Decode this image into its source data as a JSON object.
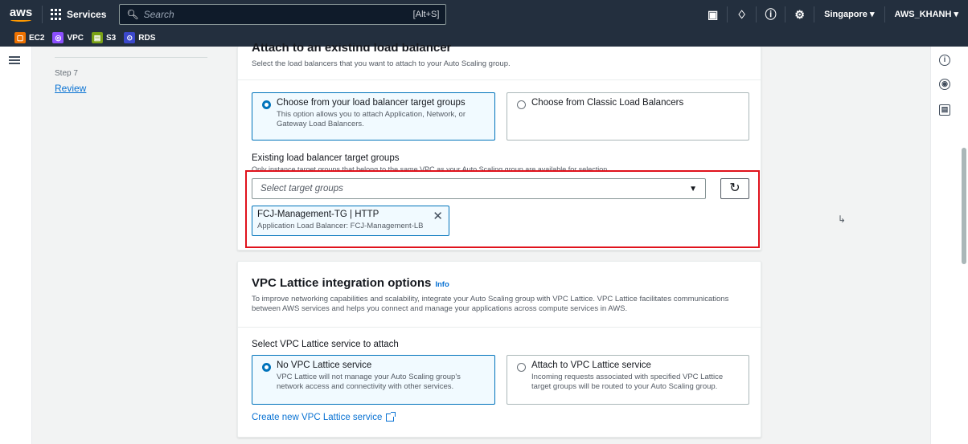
{
  "topbar": {
    "logo": "aws",
    "services_label": "Services",
    "search_placeholder": "Search",
    "search_shortcut": "[Alt+S]",
    "region": "Singapore ▾",
    "account": "AWS_KHANH ▾"
  },
  "favorites": [
    {
      "label": "EC2",
      "color": "#ed7100",
      "icon": "ec2-icon"
    },
    {
      "label": "VPC",
      "color": "#8c4fff",
      "icon": "vpc-icon"
    },
    {
      "label": "S3",
      "color": "#7aa116",
      "icon": "s3-icon"
    },
    {
      "label": "RDS",
      "color": "#3b48cc",
      "icon": "rds-icon"
    }
  ],
  "steps": {
    "step_label": "Step 7",
    "step_link": "Review"
  },
  "load_balancer": {
    "heading": "Attach to an existing load balancer",
    "subtitle": "Select the load balancers that you want to attach to your Auto Scaling group.",
    "option_target_groups": {
      "title": "Choose from your load balancer target groups",
      "desc": "This option allows you to attach Application, Network, or Gateway Load Balancers."
    },
    "option_classic": {
      "title": "Choose from Classic Load Balancers"
    },
    "existing_label": "Existing load balancer target groups",
    "existing_desc": "Only instance target groups that belong to the same VPC as your Auto Scaling group are available for selection.",
    "select_placeholder": "Select target groups",
    "selected_token": {
      "name": "FCJ-Management-TG | HTTP",
      "detail": "Application Load Balancer: FCJ-Management-LB"
    }
  },
  "lattice": {
    "heading": "VPC Lattice integration options",
    "info": "Info",
    "subtitle": "To improve networking capabilities and scalability, integrate your Auto Scaling group with VPC Lattice. VPC Lattice facilitates communications between AWS services and helps you connect and manage your applications across compute services in AWS.",
    "select_label": "Select VPC Lattice service to attach",
    "option_none": {
      "title": "No VPC Lattice service",
      "desc": "VPC Lattice will not manage your Auto Scaling group's network access and connectivity with other services."
    },
    "option_attach": {
      "title": "Attach to VPC Lattice service",
      "desc": "Incoming requests associated with specified VPC Lattice target groups will be routed to your Auto Scaling group."
    },
    "create_link": "Create new VPC Lattice service"
  }
}
